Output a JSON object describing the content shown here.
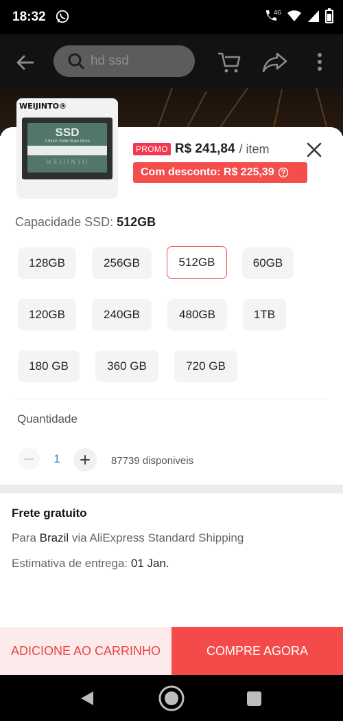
{
  "status_bar": {
    "time": "18:32",
    "network": "4G"
  },
  "app_bar": {
    "search_text": "hd ssd"
  },
  "product": {
    "thumb_brand": "WEIJINTO®",
    "ssd_title": "SSD",
    "ssd_subtitle": "2.5inch Solid State Drive",
    "ssd_brand": "WEIJINTO",
    "promo_label": "PROMO",
    "price": "R$ 241,84",
    "per_item": "/ item",
    "discount_text": "Com desconto: R$ 225,39"
  },
  "capacity": {
    "label": "Capacidade SSD:",
    "selected_value": "512GB",
    "options": [
      "128GB",
      "256GB",
      "512GB",
      "60GB",
      "120GB",
      "240GB",
      "480GB",
      "1TB",
      "180 GB",
      "360 GB",
      "720 GB"
    ]
  },
  "quantity": {
    "label": "Quantidade",
    "value": "1",
    "available": "87739 disponiveis"
  },
  "shipping": {
    "title": "Frete gratuito",
    "to_prefix": "Para",
    "country": "Brazil",
    "via_text": "via AliExpress Standard Shipping",
    "eta_label": "Estimativa de entrega:",
    "eta_value": "01 Jan."
  },
  "actions": {
    "add_to_cart": "ADICIONE AO CARRINHO",
    "buy_now": "COMPRE AGORA"
  },
  "colors": {
    "accent": "#F54A4A",
    "promo": "#F23852",
    "selected_border": "#EA4D4D",
    "qty_value": "#2A8BC8"
  }
}
